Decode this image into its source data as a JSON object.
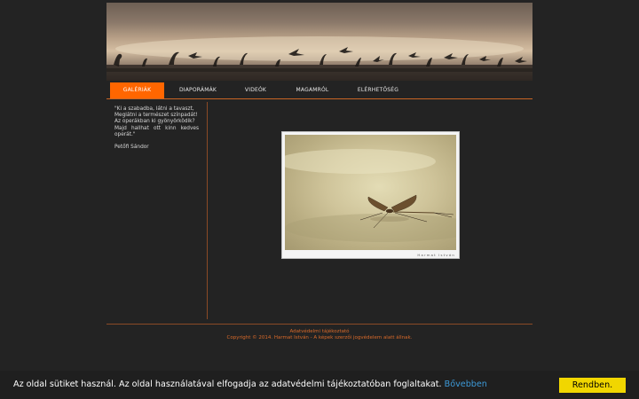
{
  "nav": {
    "items": [
      {
        "label": "GALÉRIÁK",
        "active": true
      },
      {
        "label": "DIAPORÁMÁK",
        "active": false
      },
      {
        "label": "VIDEÓK",
        "active": false
      },
      {
        "label": "MAGAMRÓL",
        "active": false
      },
      {
        "label": "ELÉRHETŐSÉG",
        "active": false
      }
    ]
  },
  "sidebar": {
    "quote_lines": "\"Ki a szabadba, látni a tavaszt,\n    Meglátni a természet színpadát!\n    Az operákban ki gyönyörködik?\n Majd hallhat ott kinn kedves operát.\"",
    "author": "Petőfi Sándor"
  },
  "photo": {
    "watermark": "Harmat István"
  },
  "footer": {
    "privacy_link": "Adatvédelmi tájékoztató",
    "copyright": "Copyright © 2014. Harmat István - A képek szerzői jogvédelem alatt állnak."
  },
  "cookie": {
    "text": "Az oldal sütiket használ. Az oldal használatával elfogadja az adatvédelmi tájékoztatóban foglaltakat.",
    "more_link": "Bővebben",
    "accept_button": "Rendben."
  },
  "colors": {
    "accent": "#ff6600",
    "background": "#232323",
    "cookie_button": "#f1d600",
    "cookie_link": "#3d9ad8"
  }
}
